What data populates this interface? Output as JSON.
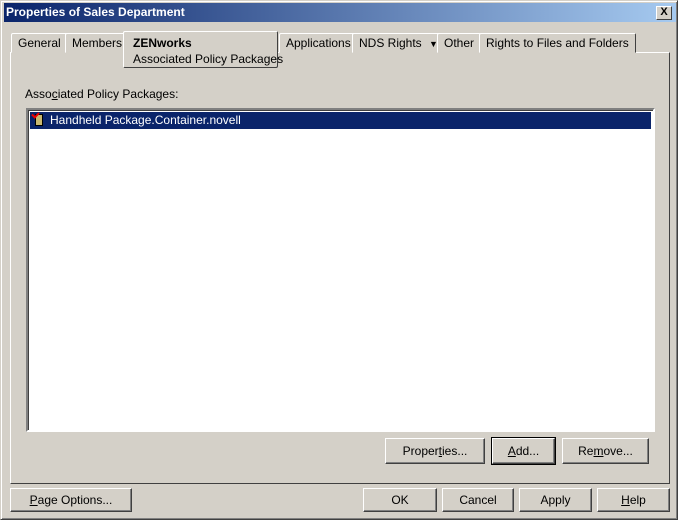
{
  "window": {
    "title": "Properties of Sales Department",
    "close_label": "X"
  },
  "tabs": [
    {
      "label": "General"
    },
    {
      "label": "Members"
    },
    {
      "label": "ZENworks",
      "sublabel": "Associated Policy Packages",
      "active": true
    },
    {
      "label": "Applications"
    },
    {
      "label": "NDS Rights",
      "dropdown": "▼"
    },
    {
      "label": "Other"
    },
    {
      "label": "Rights to Files and Folders"
    }
  ],
  "main": {
    "list_label": {
      "pre": "Asso",
      "acc": "c",
      "post": "iated Policy Packages:"
    },
    "items": [
      {
        "label": "Handheld Package.Container.novell",
        "selected": true,
        "icon": "handheld-policy-icon"
      }
    ]
  },
  "buttons": {
    "properties": {
      "pre": "Proper",
      "acc": "t",
      "post": "ies..."
    },
    "add": {
      "pre": "",
      "acc": "A",
      "post": "dd..."
    },
    "remove": {
      "pre": "Re",
      "acc": "m",
      "post": "ove..."
    },
    "page_options": {
      "pre": "",
      "acc": "P",
      "post": "age Options..."
    },
    "ok": "OK",
    "cancel": "Cancel",
    "apply": "Apply",
    "help": {
      "pre": "",
      "acc": "H",
      "post": "elp"
    }
  }
}
